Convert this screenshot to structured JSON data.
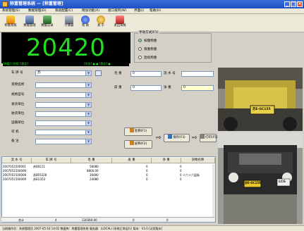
{
  "window": {
    "title": "称重管理系统 — [称重管理]",
    "minimize": "_",
    "maximize": "□",
    "close": "×"
  },
  "menu": [
    "系统管理(S)",
    "数据管理(D)",
    "系统配置(C)",
    "附加功能(A)",
    "窗口排列(W)",
    "界面(I)",
    "帮助(H)"
  ],
  "toolbar": [
    "称重系统",
    "数据管理",
    "数据记录",
    "计算器",
    "帮 助",
    "关 于",
    "退出系统"
  ],
  "display": {
    "weight": "20420",
    "status_left": "[称量] [合格] [稳定]",
    "status_right": "[状态] ● ● [稳定] ●"
  },
  "mode": {
    "title": "手动方式(F1)",
    "options": [
      "按键称重",
      "限重称重",
      "连续称重"
    ],
    "selected": 0
  },
  "form": {
    "fields": [
      {
        "label": "车 牌 号",
        "value": "苏"
      },
      {
        "label": "货物名称",
        "value": ""
      },
      {
        "label": "规格型号",
        "value": ""
      },
      {
        "label": "发货单位",
        "value": ""
      },
      {
        "label": "收货单位",
        "value": ""
      },
      {
        "label": "运输单位",
        "value": ""
      },
      {
        "label": "司    机",
        "value": ""
      },
      {
        "label": "备    注",
        "value": ""
      }
    ]
  },
  "weights": {
    "gross_label": "毛  重",
    "gross_value": "0",
    "serial_label": "流 水 号",
    "serial_value": "",
    "tare_label": "皮  重",
    "tare_value": "0",
    "net_label": "净  重",
    "net_value": "0"
  },
  "actions": {
    "weigh_gross": "毛称(F1)",
    "weigh_tare": "皮称(F2)",
    "save": "保存(F3)",
    "print": "打印(F5)"
  },
  "table": {
    "columns": [
      "流 水 号",
      "车 牌 号",
      "毛  重",
      "皮  重",
      "净  重",
      "货物名称"
    ],
    "rows": [
      [
        "2007051500001",
        "苏B0211",
        "58080",
        "0",
        "0",
        ""
      ],
      [
        "2007051500006",
        "",
        "8800.00",
        "0",
        "0",
        ""
      ],
      [
        "2007051500008",
        "苏BF0228",
        "39480",
        "0",
        "0",
        "十六十六层板"
      ],
      [
        "2007051500009",
        "苏EG352",
        "24080",
        "0",
        "0",
        ""
      ]
    ],
    "total": {
      "label": "合计",
      "count": "4",
      "gross": "130360.00",
      "tare": "0",
      "net": "0"
    }
  },
  "camera": {
    "plate_top": "苏E·GC155",
    "plate_bottom": "苏E·GC155",
    "plate_side": "LCG"
  },
  "statusbar": "当前操作员：系统管理员    2007-05-16  14:02    数据库：称重管理系统  服务器：(LOCAL)    [系统正常运行]    版本：V3.0 [试用版本]"
}
